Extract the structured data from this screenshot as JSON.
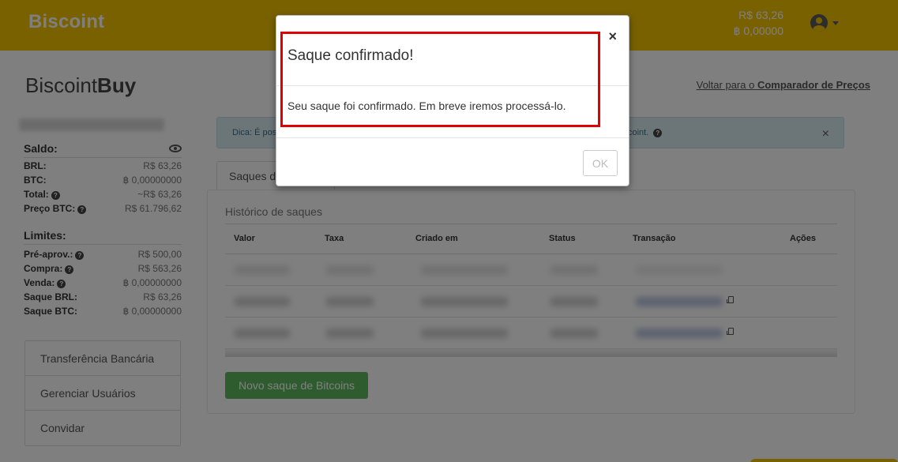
{
  "header": {
    "logo": "Biscoint",
    "balance_brl": "R$ 63,26",
    "balance_btc": "฿ 0,00000"
  },
  "page": {
    "brand_light": "Biscoint",
    "brand_bold": "Buy",
    "back_prefix": "Voltar para o",
    "back_link": "Comparador de Preços"
  },
  "sidebar": {
    "saldo_title": "Saldo:",
    "saldo": [
      {
        "label": "BRL:",
        "value": "R$ 63,26",
        "help": false
      },
      {
        "label": "BTC:",
        "value": "฿ 0,00000000",
        "help": false
      },
      {
        "label": "Total:",
        "value": "~R$ 63,26",
        "help": true
      },
      {
        "label": "Preço BTC:",
        "value": "R$ 61.796,62",
        "help": true
      }
    ],
    "limites_title": "Limites:",
    "limites": [
      {
        "label": "Pré-aprov.:",
        "value": "R$ 500,00",
        "help": true
      },
      {
        "label": "Compra:",
        "value": "R$ 563,26",
        "help": true
      },
      {
        "label": "Venda:",
        "value": "฿ 0,00000000",
        "help": true
      },
      {
        "label": "Saque BRL:",
        "value": "R$ 63,26",
        "help": false
      },
      {
        "label": "Saque BTC:",
        "value": "฿ 0,00000000",
        "help": false
      }
    ],
    "menu": [
      "Transferência Bancária",
      "Gerenciar Usuários",
      "Convidar"
    ]
  },
  "alert": {
    "text_left": "Dica: É pos",
    "text_right": "coint.",
    "close": "×"
  },
  "tabs": {
    "active_label": "Saques d"
  },
  "panel": {
    "title": "Histórico de saques",
    "columns": [
      "Valor",
      "Taxa",
      "Criado em",
      "Status",
      "Transação",
      "Ações"
    ],
    "new_button": "Novo saque de Bitcoins"
  },
  "modal": {
    "title": "Saque confirmado!",
    "close": "×",
    "body": "Seu saque foi confirmado. Em breve iremos processá-lo.",
    "ok": "OK"
  },
  "colors": {
    "brand_yellow": "#f2c200",
    "highlight_red": "#e00000",
    "success_green": "#5cb85c"
  }
}
